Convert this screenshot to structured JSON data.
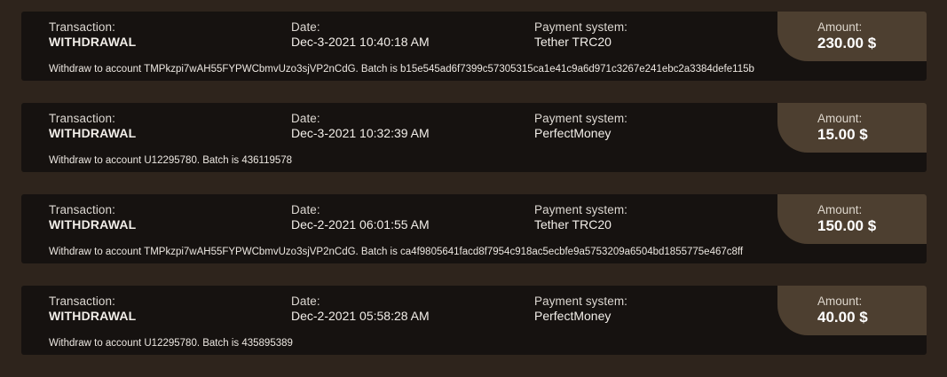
{
  "transactions": [
    {
      "transaction_label": "Transaction:",
      "transaction": "WITHDRAWAL",
      "date_label": "Date:",
      "date": "Dec-3-2021 10:40:18 AM",
      "payment_label": "Payment system:",
      "payment": "Tether TRC20",
      "amount_label": "Amount:",
      "amount": "230.00 $",
      "description": "Withdraw to account TMPkzpi7wAH55FYPWCbmvUzo3sjVP2nCdG. Batch is b15e545ad6f7399c57305315ca1e41c9a6d971c3267e241ebc2a3384defe115b"
    },
    {
      "transaction_label": "Transaction:",
      "transaction": "WITHDRAWAL",
      "date_label": "Date:",
      "date": "Dec-3-2021 10:32:39 AM",
      "payment_label": "Payment system:",
      "payment": "PerfectMoney",
      "amount_label": "Amount:",
      "amount": "15.00 $",
      "description": "Withdraw to account U12295780. Batch is 436119578"
    },
    {
      "transaction_label": "Transaction:",
      "transaction": "WITHDRAWAL",
      "date_label": "Date:",
      "date": "Dec-2-2021 06:01:55 AM",
      "payment_label": "Payment system:",
      "payment": "Tether TRC20",
      "amount_label": "Amount:",
      "amount": "150.00 $",
      "description": "Withdraw to account TMPkzpi7wAH55FYPWCbmvUzo3sjVP2nCdG. Batch is ca4f9805641facd8f7954c918ac5ecbfe9a5753209a6504bd1855775e467c8ff"
    },
    {
      "transaction_label": "Transaction:",
      "transaction": "WITHDRAWAL",
      "date_label": "Date:",
      "date": "Dec-2-2021 05:58:28 AM",
      "payment_label": "Payment system:",
      "payment": "PerfectMoney",
      "amount_label": "Amount:",
      "amount": "40.00 $",
      "description": "Withdraw to account U12295780. Batch is 435895389"
    }
  ]
}
